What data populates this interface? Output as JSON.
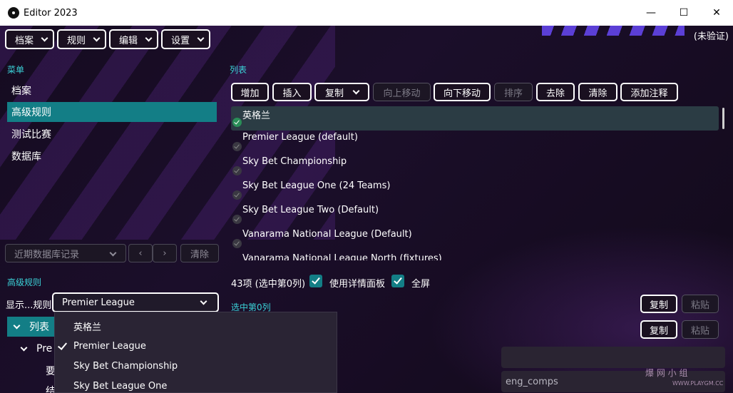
{
  "window": {
    "title": "Editor 2023",
    "min": "—",
    "max": "☐",
    "close": "✕"
  },
  "menubar": [
    {
      "label": "档案"
    },
    {
      "label": "规则"
    },
    {
      "label": "编辑"
    },
    {
      "label": "设置"
    }
  ],
  "status": {
    "unverified": "(未验证)"
  },
  "sidebar": {
    "menu_label": "菜单",
    "items": [
      {
        "label": "档案"
      },
      {
        "label": "高级规则",
        "active": true
      },
      {
        "label": "测试比赛"
      },
      {
        "label": "数据库"
      }
    ],
    "recent_db_placeholder": "近期数据库记录",
    "prev_icon": "‹",
    "next_icon": "›",
    "clear_label": "清除",
    "advanced_rules_label": "高级规则",
    "show_rules_label": "显示...规则",
    "rules_selected": "Premier League",
    "tree": [
      {
        "label": "列表",
        "expanded": true
      },
      {
        "label": "Pre"
      },
      {
        "label": "要"
      },
      {
        "label": "结"
      }
    ]
  },
  "dropdown": {
    "options": [
      {
        "label": "英格兰",
        "checked": false
      },
      {
        "label": "Premier League",
        "checked": true
      },
      {
        "label": "Sky Bet Championship",
        "checked": false
      },
      {
        "label": "Sky Bet League One",
        "checked": false
      }
    ]
  },
  "list_panel": {
    "label": "列表",
    "toolbar": {
      "add": "增加",
      "insert": "插入",
      "copy": "复制",
      "move_up": "向上移动",
      "move_down": "向下移动",
      "sort": "排序",
      "remove": "去除",
      "clear": "清除",
      "add_note": "添加注释"
    },
    "items": [
      {
        "label": "英格兰",
        "checked": true,
        "selected": true
      },
      {
        "label": "Premier League (default)",
        "checked": false
      },
      {
        "label": "Sky Bet Championship",
        "checked": false
      },
      {
        "label": "Sky Bet League One (24 Teams)",
        "checked": false
      },
      {
        "label": "Sky Bet League Two (Default)",
        "checked": false
      },
      {
        "label": "Vanarama National League (Default)",
        "checked": false
      },
      {
        "label": "Vanarama National League North (fixtures)",
        "checked": false
      }
    ],
    "count_text": "43项 (选中第0列)",
    "use_details_label": "使用详情面板",
    "fullscreen_label": "全屏",
    "selected_label": "选中第0列",
    "copy_label": "复制",
    "paste_label": "粘贴",
    "field_value": "eng_comps"
  },
  "watermark": {
    "text": "爆 网 小 组",
    "sub": "WWW.PLAYGM.CC"
  },
  "colors": {
    "accent": "#137e86",
    "section": "#3bd2d8",
    "background": "#150b20"
  }
}
